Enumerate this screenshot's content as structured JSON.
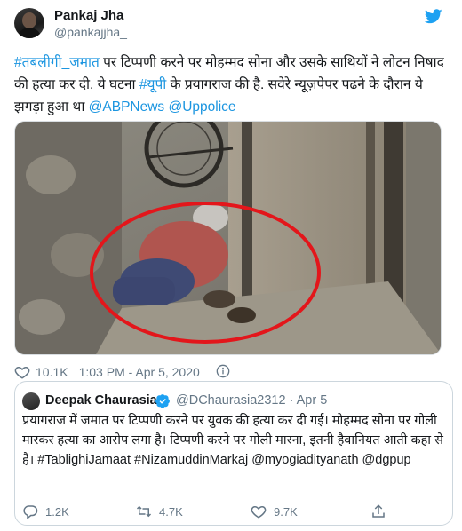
{
  "tweet": {
    "author_name": "Pankaj Jha",
    "author_handle": "@pankajjha_",
    "text_part1": "#तबलीगी_जमात",
    "text_part2": " पर टिप्पणी करने पर मोहम्मद सोना और उसके साथियों ने लोटन निषाद की हत्या कर दी. ये घटना ",
    "text_part3": "#यूपी",
    "text_part4": " के प्रयागराज की है. सवेरे न्यूज़पेपर पढने के दौरान ये झगड़ा हुआ था ",
    "text_part5": "@ABPNews",
    "text_part6": " ",
    "text_part7": "@Uppolice",
    "likes": "10.1K",
    "timestamp": "1:03 PM - Apr 5, 2020"
  },
  "quoted": {
    "author_name": "Deepak Chaurasia",
    "author_handle": "@DChaurasia2312 · Apr 5",
    "text": "प्रयागराज में जमात पर टिप्पणी करने पर युवक की हत्या कर दी गई। मोहम्मद सोना पर गोली मारकर हत्या का आरोप लगा है। टिप्पणी करने पर गोली मारना, इतनी हैवानियत आती कहा से है। #TablighiJamaat #NizamuddinMarkaj @myogiadityanath @dgpup",
    "reply_count": "1.2K",
    "retweet_count": "4.7K",
    "like_count": "9.7K"
  },
  "colors": {
    "link": "#1b95e0",
    "annotation_circle": "#e3161b",
    "twitter_blue": "#1da1f2",
    "like_red": "#e0245e"
  },
  "icons": {
    "bird": "twitter-bird-icon",
    "heart": "heart-icon",
    "info": "info-icon",
    "verified": "verified-badge-icon",
    "reply": "reply-icon",
    "retweet": "retweet-icon",
    "share": "share-icon"
  }
}
